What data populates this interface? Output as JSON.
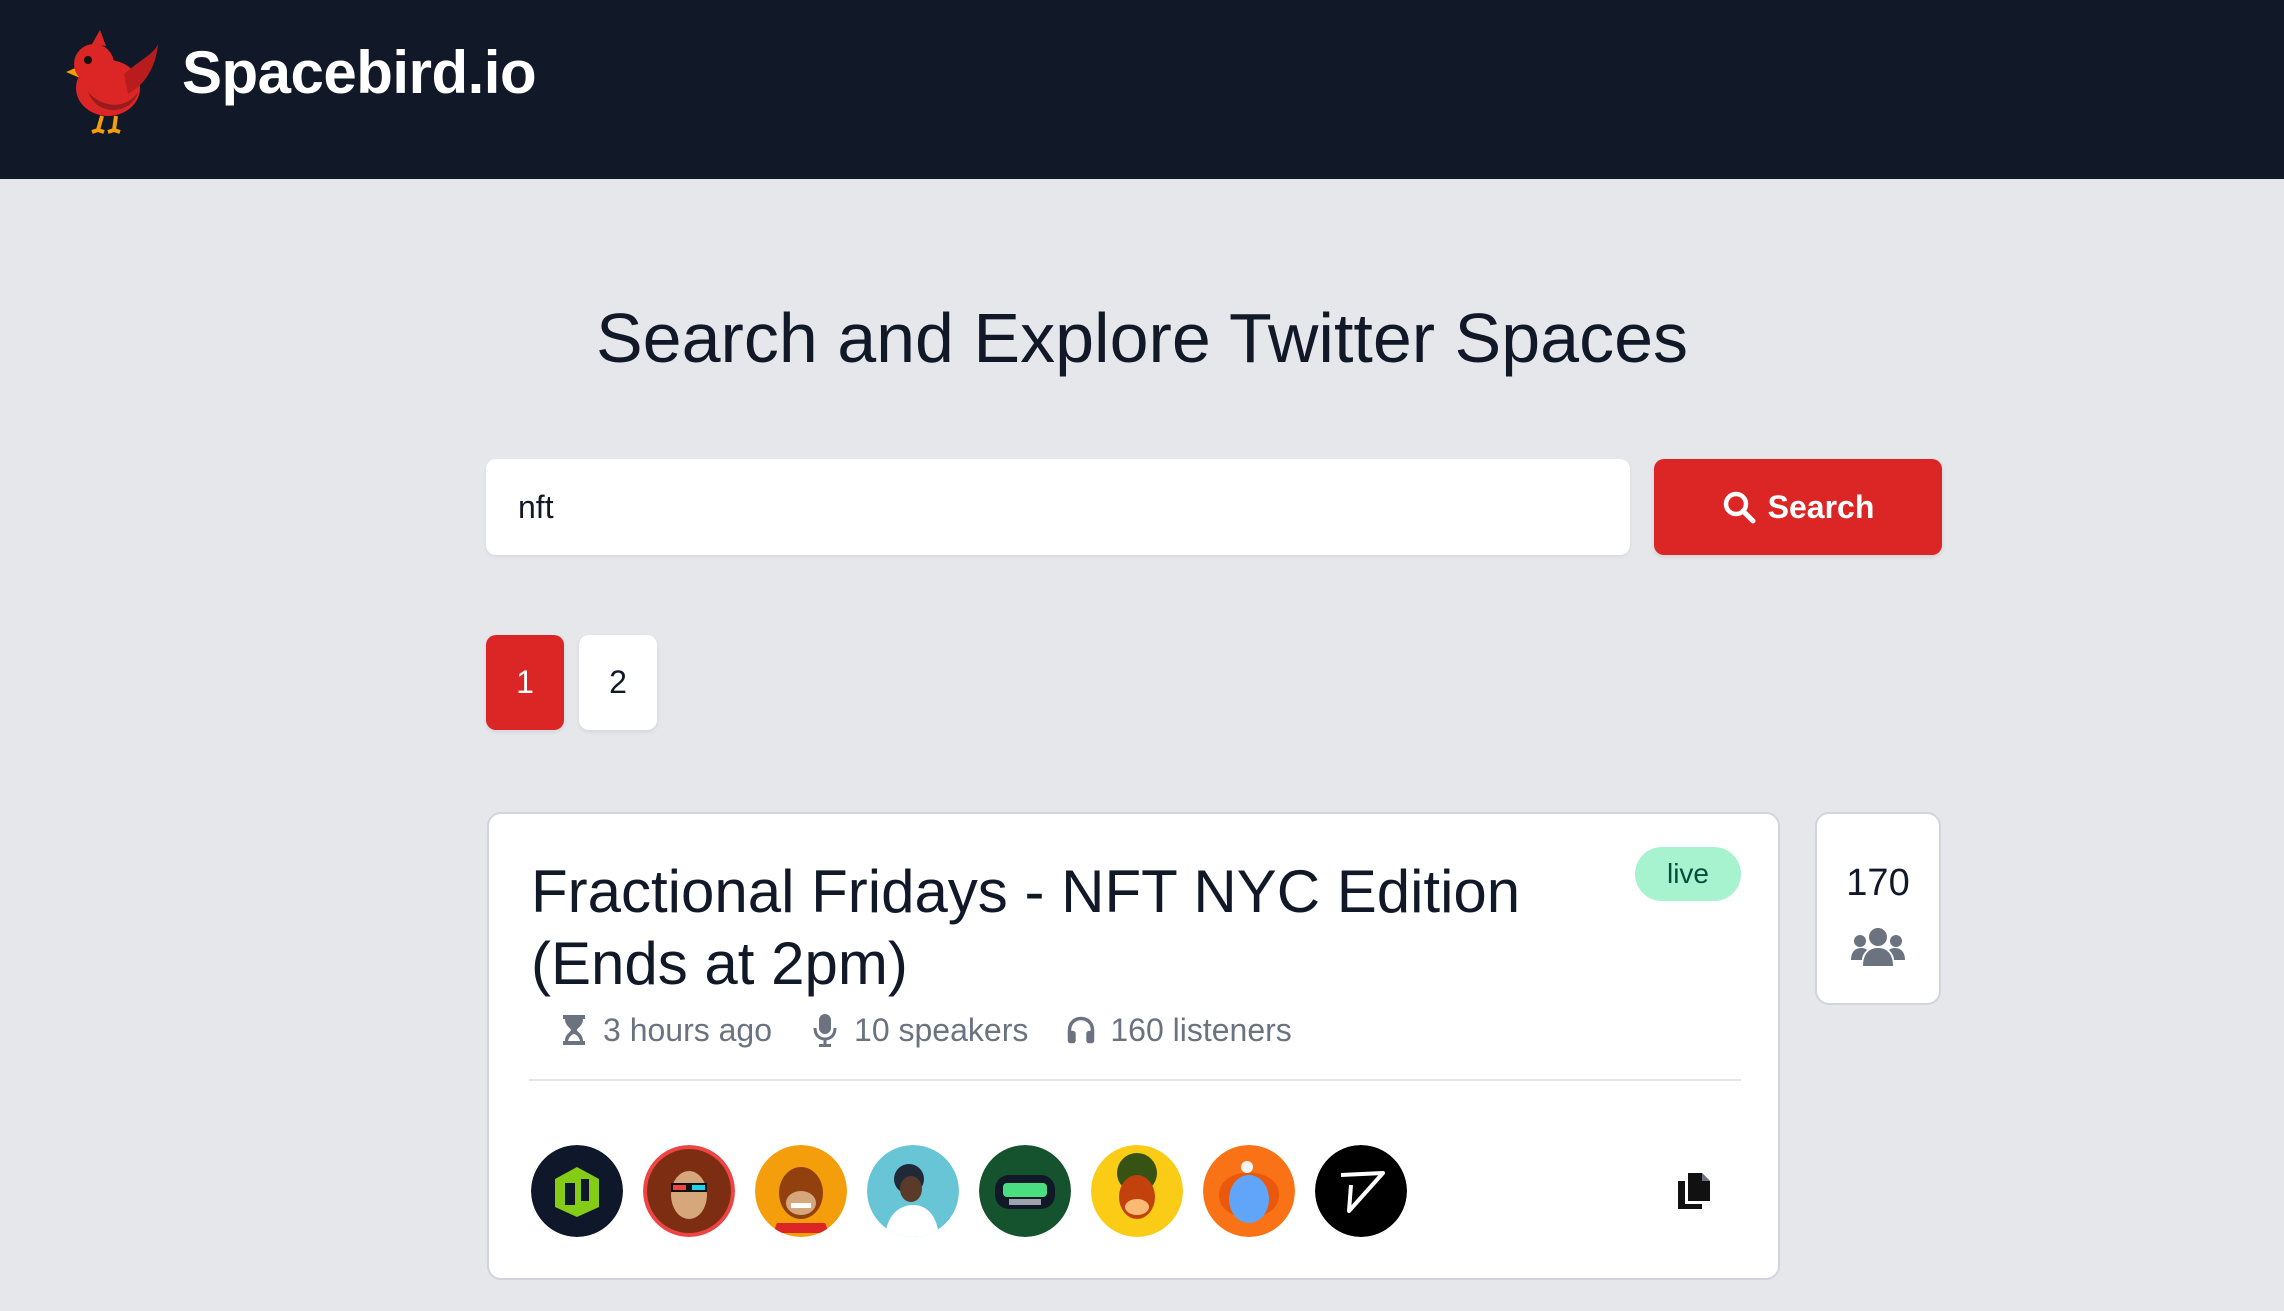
{
  "app": {
    "name": "Spacebird.io"
  },
  "page": {
    "title": "Search and Explore Twitter Spaces"
  },
  "search": {
    "value": "nft",
    "placeholder": "",
    "button_label": "Search"
  },
  "pagination": {
    "pages": [
      "1",
      "2"
    ],
    "current": "1"
  },
  "results": [
    {
      "title": "Fractional Fridays - NFT NYC Edition (Ends at 2pm)",
      "status": "live",
      "started": "3 hours ago",
      "speakers": "10 speakers",
      "listeners": "160 listeners",
      "total_count": "170",
      "avatars": [
        "avatar-1",
        "avatar-2",
        "avatar-3",
        "avatar-4",
        "avatar-5",
        "avatar-6",
        "avatar-7",
        "avatar-8"
      ]
    }
  ],
  "colors": {
    "header_bg": "#111827",
    "page_bg": "#e5e7eb",
    "accent": "#dc2626",
    "live_badge": "#a7f3d0",
    "muted_text": "#6b7280"
  },
  "icons": [
    "bird-logo-icon",
    "search-icon",
    "hourglass-icon",
    "microphone-icon",
    "headphones-icon",
    "copy-icon",
    "users-icon"
  ]
}
